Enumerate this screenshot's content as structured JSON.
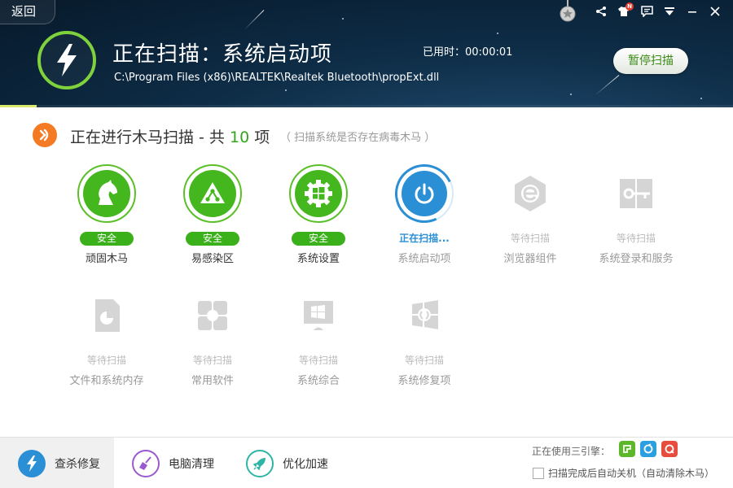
{
  "header": {
    "back_label": "返回",
    "scan_title": "正在扫描：系统启动项",
    "scan_path": "C:\\Program Files (x86)\\REALTEK\\Realtek Bluetooth\\propExt.dll",
    "elapsed": "已用时：00:00:01",
    "pause_label": "暂停扫描",
    "notification_badge": "N",
    "accent_color": "#7fd23c"
  },
  "summary": {
    "title_prefix": "正在进行木马扫描 - 共",
    "count": "10",
    "title_suffix": "项",
    "hint": "（ 扫描系统是否存在病毒木马 ）"
  },
  "items": [
    {
      "status": "安全",
      "label": "顽固木马",
      "state": "done",
      "icon": "horse-icon"
    },
    {
      "status": "安全",
      "label": "易感染区",
      "state": "done",
      "icon": "network-triangle-icon"
    },
    {
      "status": "安全",
      "label": "系统设置",
      "state": "done",
      "icon": "windows-gear-icon"
    },
    {
      "status": "正在扫描...",
      "label": "系统启动项",
      "state": "active",
      "icon": "power-icon"
    },
    {
      "status": "等待扫描",
      "label": "浏览器组件",
      "state": "waiting",
      "icon": "browser-e-icon"
    },
    {
      "status": "等待扫描",
      "label": "系统登录和服务",
      "state": "waiting",
      "icon": "login-service-icon"
    },
    {
      "status": "等待扫描",
      "label": "文件和系统内存",
      "state": "waiting",
      "icon": "file-memory-icon"
    },
    {
      "status": "等待扫描",
      "label": "常用软件",
      "state": "waiting",
      "icon": "software-icon"
    },
    {
      "status": "等待扫描",
      "label": "系统综合",
      "state": "waiting",
      "icon": "system-general-icon"
    },
    {
      "status": "等待扫描",
      "label": "系统修复项",
      "state": "waiting",
      "icon": "system-repair-icon"
    }
  ],
  "bottom": {
    "tabs": [
      {
        "label": "查杀修复",
        "icon": "bolt-icon",
        "color": "#2b8fd6"
      },
      {
        "label": "电脑清理",
        "icon": "broom-icon",
        "color": "#9b59d0"
      },
      {
        "label": "优化加速",
        "icon": "rocket-icon",
        "color": "#2fb5a5"
      }
    ],
    "engines_label": "正在使用三引擎：",
    "engines": [
      {
        "name": "engine-green",
        "color": "#5cb82a"
      },
      {
        "name": "engine-blue",
        "color": "#2b9fe0"
      },
      {
        "name": "engine-red",
        "color": "#e74c3c"
      }
    ],
    "auto_shutdown": "扫描完成后自动关机（自动清除木马）"
  },
  "colors": {
    "safe": "#3ab01a",
    "active": "#2b8fd6",
    "waiting": "#c8c8c8",
    "header_bg": "#0e2d47"
  }
}
